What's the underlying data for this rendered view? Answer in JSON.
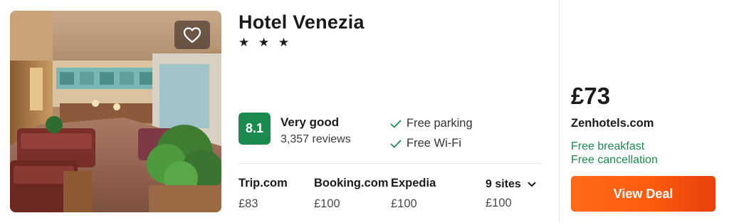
{
  "hotel": {
    "name": "Hotel Venezia",
    "stars": "★ ★ ★",
    "favorite_icon": "heart-outline-icon",
    "photo_alt": "Hotel lobby"
  },
  "rating": {
    "score": "8.1",
    "label": "Very good",
    "reviews": "3,357 reviews",
    "badge_color": "#1a8a4f"
  },
  "amenities": [
    {
      "icon": "check-icon",
      "label": "Free parking"
    },
    {
      "icon": "check-icon",
      "label": "Free Wi-Fi"
    }
  ],
  "sites": [
    {
      "name": "Trip.com",
      "price": "£83"
    },
    {
      "name": "Booking.com",
      "price": "£100"
    },
    {
      "name": "Expedia",
      "price": "£100"
    }
  ],
  "more_sites": {
    "label": "9 sites",
    "price": "£100",
    "icon": "chevron-down-icon"
  },
  "deal": {
    "price": "£73",
    "site": "Zenhotels.com",
    "perks": [
      "Free breakfast",
      "Free cancellation"
    ],
    "button_label": "View Deal",
    "perk_color": "#1a8a4f",
    "button_color": "#ff5a0f"
  }
}
